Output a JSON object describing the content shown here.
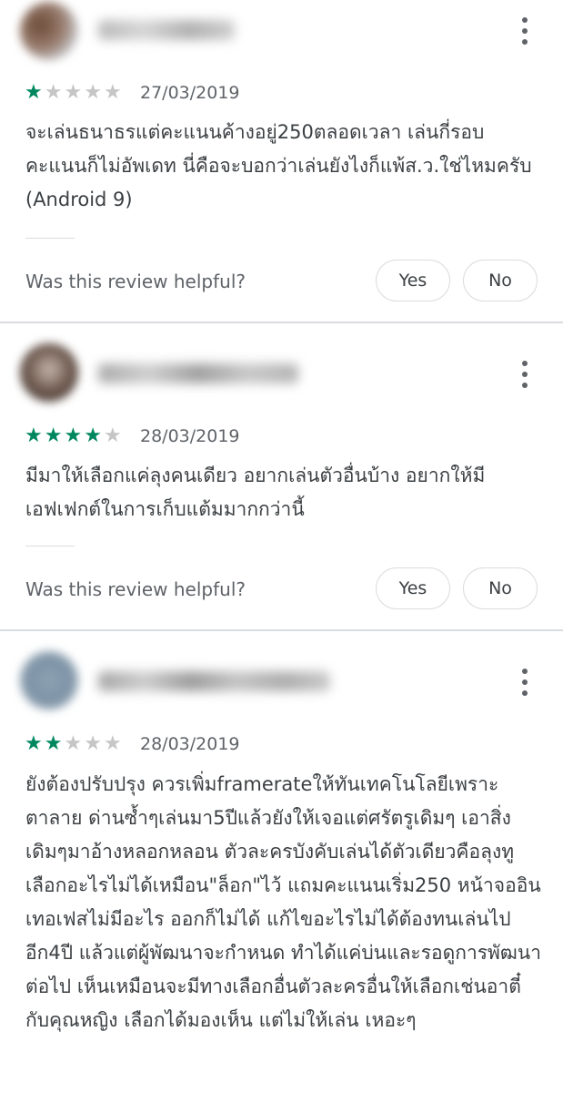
{
  "reviews": [
    {
      "rating": 1,
      "date": "27/03/2019",
      "text": "จะเล่นธนาธรแต่คะแนนค้างอยู่250ตลอดเวลา เล่นกี่รอบคะแนนก็ไม่อัพเดท นี่คือจะบอกว่าเล่นยังไงก็แพ้ส.ว.ใช่ไหมครับ (Android 9)",
      "helpful_prompt": "Was this review helpful?",
      "yes_label": "Yes",
      "no_label": "No"
    },
    {
      "rating": 4,
      "date": "28/03/2019",
      "text": "มีมาให้เลือกแค่ลุงคนเดียว อยากเล่นตัวอื่นบ้าง อยากให้มีเอฟเฟกต์ในการเก็บแต้มมากกว่านี้",
      "helpful_prompt": "Was this review helpful?",
      "yes_label": "Yes",
      "no_label": "No"
    },
    {
      "rating": 2,
      "date": "28/03/2019",
      "text": "ยังต้องปรับปรุง ควรเพิ่มframerateให้ทันเทคโนโลยีเพราะตาลาย ด่านซ้ำๆเล่นมา5ปีแล้วยังให้เจอแต่ศรัตรูเดิมๆ เอาสิ่งเดิมๆมาอ้างหลอกหลอน ตัวละครบังคับเล่นได้ตัวเดียวคือลุงทูเลือกอะไรไม่ได้เหมือน\"ล็อก\"ไว้ แถมคะแนนเริ่ม250 หน้าจออินเทอเฟสไม่มีอะไร ออกก็ไม่ได้ แก้ไขอะไรไม่ได้ต้องทนเล่นไปอีก4ปี แล้วแต่ผู้พัฒนาจะกำหนด ทำได้แค่บ่นและรอดูการพัฒนาต่อไป เห็นเหมือนจะมีทางเลือกอื่นตัวละครอื่นให้เลือกเช่นอาตี๋กับคุณหญิง เลือกได้มองเห็น แต่ไม่ให้เล่น เหอะๆ"
    }
  ],
  "colors": {
    "star_filled": "#01875f",
    "star_empty": "#c6c6c6",
    "divider": "#dadce0"
  },
  "icons": {
    "more": "more-vert-icon",
    "star": "star-icon"
  }
}
